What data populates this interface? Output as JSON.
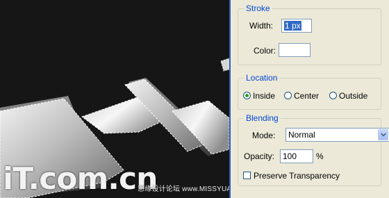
{
  "watermark": {
    "logo": "iT.com.cn",
    "site": "思缘设计论坛 www.MISSYUAN.com"
  },
  "stroke": {
    "legend": "Stroke",
    "width_label": "Width:",
    "width_value": "1 px",
    "color_label": "Color:",
    "color_value": "#ffffff"
  },
  "location": {
    "legend": "Location",
    "options": [
      "Inside",
      "Center",
      "Outside"
    ],
    "selected": "Inside"
  },
  "blending": {
    "legend": "Blending",
    "mode_label": "Mode:",
    "mode_value": "Normal",
    "opacity_label": "Opacity:",
    "opacity_value": "100",
    "opacity_unit": "%",
    "preserve_label": "Preserve Transparency",
    "preserve_checked": false
  },
  "colors": {
    "legend_blue": "#0046d5",
    "panel_bg": "#ece9d8",
    "canvas_bg": "#161616"
  }
}
